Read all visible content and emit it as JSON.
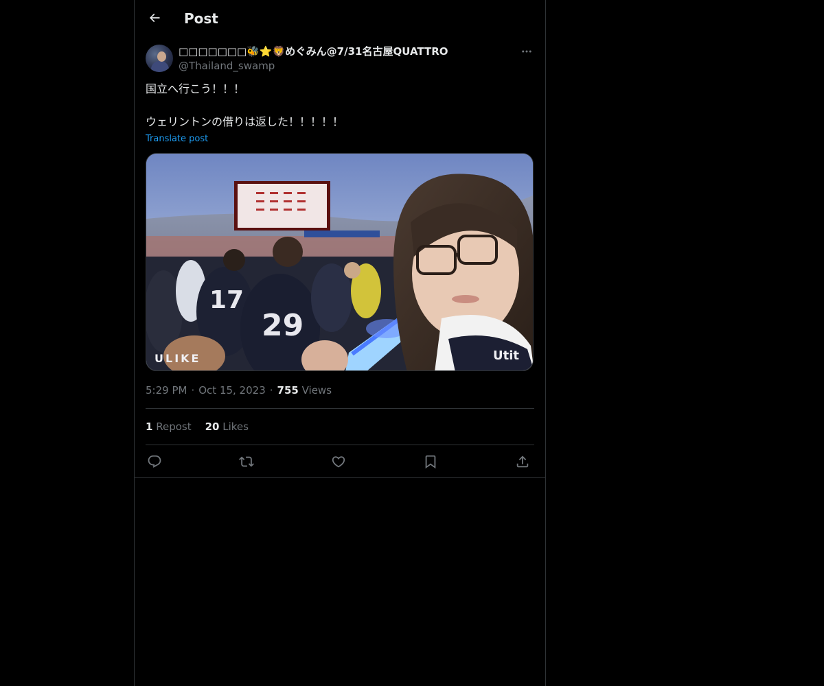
{
  "header": {
    "title": "Post",
    "back_icon": "arrow-left-icon"
  },
  "author": {
    "display_name": "□□□□□□□🐝⭐🦁めぐみん@7/31名古屋QUATTRO",
    "handle": "@Thailand_swamp",
    "more_icon": "more-horizontal-icon"
  },
  "post": {
    "lines": [
      "国立へ行こう！！！",
      "ウェリントンの借りは返した！！！！！"
    ],
    "translate_label": "Translate post"
  },
  "meta": {
    "time": "5:29 PM",
    "date": "Oct 15, 2023",
    "separator": "·",
    "views_count": "755",
    "views_label": "Views"
  },
  "stats": {
    "reposts_count": "1",
    "reposts_label": "Repost",
    "likes_count": "20",
    "likes_label": "Likes"
  },
  "actions": {
    "reply_icon": "reply-icon",
    "repost_icon": "repost-icon",
    "like_icon": "heart-icon",
    "bookmark_icon": "bookmark-icon",
    "share_icon": "share-icon"
  },
  "colors": {
    "background": "#000000",
    "text": "#e7e9ea",
    "muted": "#71767b",
    "accent": "#1d9bf0",
    "border": "#2f3336"
  }
}
